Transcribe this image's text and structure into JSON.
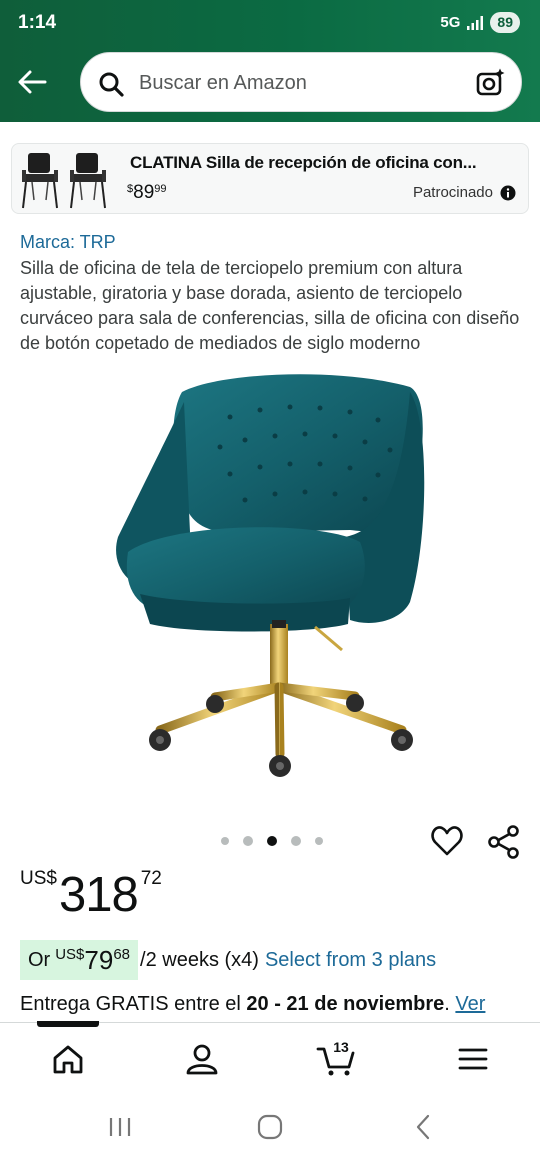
{
  "status_bar": {
    "time": "1:14",
    "network": "5G",
    "battery": "89"
  },
  "header": {
    "search_placeholder": "Buscar en Amazon"
  },
  "sponsored": {
    "title": "CLATINA Silla de recepción de oficina con...",
    "price_currency": "$",
    "price_whole": "89",
    "price_fraction": "99",
    "label": "Patrocinado"
  },
  "product": {
    "brand": "Marca: TRP",
    "title": "Silla de oficina de tela de terciopelo premium con altura ajustable, giratoria y base dorada, asiento de terciopelo curváceo para sala de conferencias, silla de oficina con diseño de botón copetado de mediados de siglo moderno",
    "image_icon": "teal-velvet-office-chair-image",
    "carousel": {
      "total": 5,
      "active_index": 2
    },
    "price": {
      "currency": "US$",
      "whole": "318",
      "fraction": "72"
    },
    "installment": {
      "prefix": "Or",
      "currency": "US$",
      "whole": "79",
      "fraction": "68",
      "period": "/2 weeks (x4)",
      "plans_link": "Select from 3 plans"
    },
    "delivery": {
      "prefix": "Entrega GRATIS entre el",
      "dates": "20 - 21 de noviembre",
      "suffix": ".",
      "link": "Ver"
    }
  },
  "bottom_nav": {
    "items": [
      "home-icon",
      "account-icon",
      "cart-icon",
      "menu-icon"
    ],
    "cart_count": "13",
    "active": "home"
  },
  "colors": {
    "header_green": "#0b6b43",
    "link_blue": "#1d6a98",
    "installment_badge": "#d7f5df",
    "chair_teal": "#14606b",
    "chair_base_gold": "#c9a640"
  }
}
